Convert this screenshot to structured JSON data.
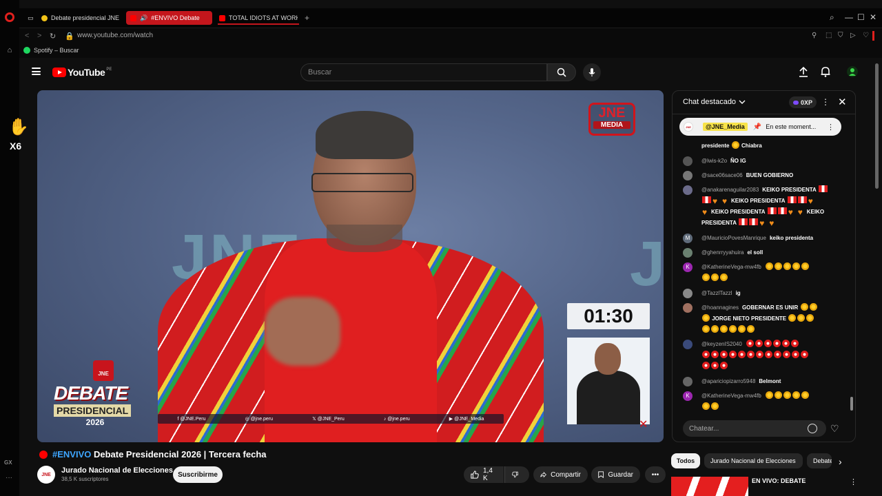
{
  "browser": {
    "tabs": [
      {
        "label": "Debate presidencial JNE E",
        "favicon_color": "#f2c318"
      },
      {
        "label": "#ENVIVO Debate",
        "favicon_color": "#ff0000"
      },
      {
        "label": "TOTAL IDIOTS AT WORK#",
        "favicon_color": "#ff0000"
      }
    ],
    "new_tab": "+",
    "url": "www.youtube.com/watch",
    "bookmark": "Spotify – Buscar",
    "sidebar_gx": "GX",
    "sidebar_more": "···",
    "accent": "#c4161c"
  },
  "youtube": {
    "logo_text": "YouTube",
    "country": "PE",
    "search_placeholder": "Buscar"
  },
  "video": {
    "bg_text": "JNE",
    "media_logo_top": "JNE",
    "media_logo_bottom": "MEDIA",
    "timer": "01:30",
    "debate_emblem": "JNE",
    "debate_word": "DEBATE",
    "debate_sub": "PRESIDENCIAL",
    "debate_year": "2026",
    "socials": [
      "f  @JNE.Peru",
      "◎  @jne.peru",
      "𝕏  @JNE_Peru",
      "♪  @jne.peru",
      "▶  @JNE_Media"
    ],
    "reaction_count": "X6",
    "title_hash": "#ENVIVO",
    "title_rest": " Debate Presidencial 2026 | Tercera fecha",
    "channel_avatar": "JNE",
    "channel": "Jurado Nacional de Elecciones",
    "subscribers": "38,5 K suscriptores",
    "subscribe": "Suscribirme",
    "likes": "1,4 K",
    "share": "Compartir",
    "save": "Guardar"
  },
  "chat": {
    "title": "Chat destacado",
    "xp": "0XP",
    "pinned_user": "@JNE_Media",
    "pinned_text": "En este moment...",
    "partial_top": "presidente",
    "partial_top_name": "Chiabra",
    "input_placeholder": "Chatear...",
    "messages": [
      {
        "user": "@lwis-k2o",
        "text": "ÑO IG",
        "avatar": "",
        "avatar_color": "#555"
      },
      {
        "user": "@sace06sace06",
        "text": "BUEN GOBIERNO",
        "avatar": "",
        "avatar_color": "#777"
      },
      {
        "user": "@anakarenaguilar2083",
        "text": "KEIKO PRESIDENTA",
        "cont1": "KEIKO PRESIDENTA",
        "cont2": "KEIKO PRESIDENTA",
        "cont3": "KEIKO",
        "cont4": "PRESIDENTA",
        "avatar": "",
        "avatar_color": "#6b6b8a"
      },
      {
        "user": "@MauricioPovesManrique",
        "text": "keiko presidenta",
        "avatar": "M",
        "avatar_color": "#5f6b7a"
      },
      {
        "user": "@ghenrryyahuira",
        "text": "el soll",
        "avatar": "",
        "avatar_color": "#6a8070"
      },
      {
        "user": "@KatherineVega-mw4fb",
        "text": "",
        "avatar": "K",
        "avatar_color": "#9c27b0"
      },
      {
        "user": "@TazzlTazzl",
        "text": "ig",
        "avatar": "",
        "avatar_color": "#888"
      },
      {
        "user": "@hoannagines",
        "text": "GOBERNAR ES UNIR",
        "cont1": "JORGE NIETO PRESIDENTE",
        "avatar": "",
        "avatar_color": "#a07060"
      },
      {
        "user": "@keyzenIS2040",
        "text": "",
        "avatar": "",
        "avatar_color": "#3a4a7a"
      },
      {
        "user": "@apariciopizarro5948",
        "text": "Belmont",
        "avatar": "",
        "avatar_color": "#666"
      },
      {
        "user": "@KatherineVega-mw4fb",
        "text": "",
        "avatar": "K",
        "avatar_color": "#9c27b0"
      }
    ]
  },
  "chips": [
    "Todos",
    "Jurado Nacional de Elecciones",
    "Debate"
  ],
  "recommendation": {
    "title": "EN VIVO: DEBATE"
  }
}
